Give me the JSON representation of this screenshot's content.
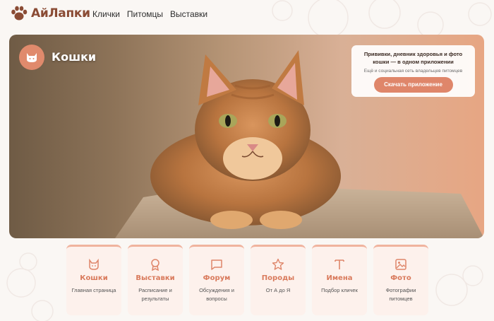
{
  "header": {
    "logo_text": "АйЛапки",
    "nav": [
      {
        "label": "Клички"
      },
      {
        "label": "Питомцы"
      },
      {
        "label": "Выставки"
      }
    ]
  },
  "hero": {
    "title": "Кошки",
    "promo": {
      "title": "Прививки, дневник здоровья и фото кошки — в одном приложении",
      "subtitle": "Ещё и социальная сеть владельцев питомцев",
      "button_label": "Скачать приложение"
    }
  },
  "cards": [
    {
      "icon": "cat-icon",
      "title": "Кошки",
      "desc": "Главная страница"
    },
    {
      "icon": "award-icon",
      "title": "Выставки",
      "desc": "Расписание и результаты"
    },
    {
      "icon": "chat-icon",
      "title": "Форум",
      "desc": "Обсуждения и вопросы"
    },
    {
      "icon": "star-icon",
      "title": "Породы",
      "desc": "От А до Я"
    },
    {
      "icon": "text-icon",
      "title": "Имена",
      "desc": "Подбор кличек"
    },
    {
      "icon": "image-icon",
      "title": "Фото",
      "desc": "Фотографии питомцев"
    }
  ],
  "colors": {
    "accent": "#df866a",
    "brand": "#8a4b34",
    "card_bg": "#fdf1ec"
  }
}
